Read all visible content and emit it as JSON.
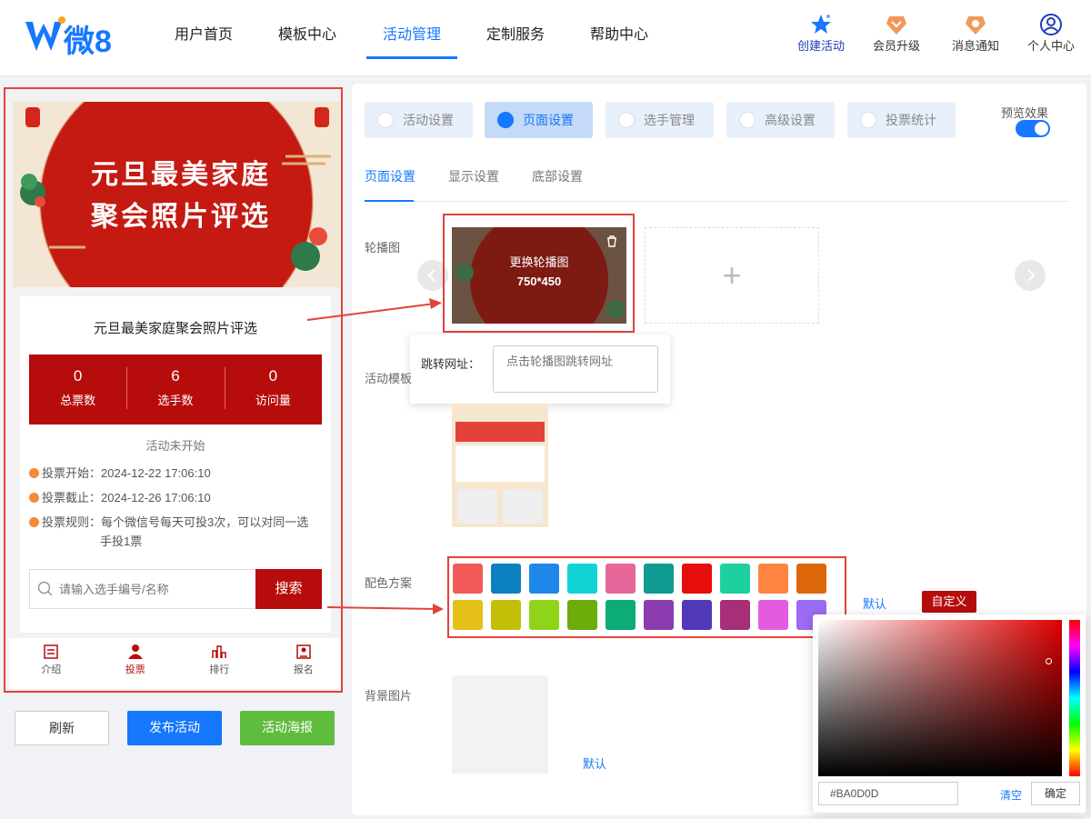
{
  "header": {
    "logo_text": "微8",
    "nav": [
      "用户首页",
      "模板中心",
      "活动管理",
      "定制服务",
      "帮助中心"
    ],
    "active_nav": "活动管理",
    "actions": [
      {
        "label": "创建活动",
        "icon": "star-icon"
      },
      {
        "label": "会员升级",
        "icon": "vip-badge-icon"
      },
      {
        "label": "消息通知",
        "icon": "bell-badge-icon"
      },
      {
        "label": "个人中心",
        "icon": "user-circle-icon"
      }
    ]
  },
  "preview": {
    "banner_line1": "元旦最美家庭",
    "banner_line2": "聚会照片评选",
    "title": "元旦最美家庭聚会照片评选",
    "stats": [
      {
        "value": "0",
        "label": "总票数"
      },
      {
        "value": "6",
        "label": "选手数"
      },
      {
        "value": "0",
        "label": "访问量"
      }
    ],
    "status": "活动未开始",
    "vote_start": "投票开始：2024-12-22 17:06:10",
    "vote_end": "投票截止：2024-12-26 17:06:10",
    "vote_rule": "投票规则：每个微信号每天可投3次，可以对同一选手投1票",
    "search_placeholder": "请输入选手编号/名称",
    "search_button": "搜索",
    "tabbar": [
      {
        "label": "介绍",
        "icon": "intro-icon"
      },
      {
        "label": "投票",
        "icon": "person-icon"
      },
      {
        "label": "排行",
        "icon": "ranking-icon"
      },
      {
        "label": "报名",
        "icon": "signup-icon"
      }
    ]
  },
  "buttons": {
    "refresh": "刷新",
    "publish": "发布活动",
    "poster": "活动海报"
  },
  "settings": {
    "tabs": [
      "活动设置",
      "页面设置",
      "选手管理",
      "高级设置",
      "投票统计"
    ],
    "active_tab": "页面设置",
    "preview_toggle_label": "预览效果",
    "preview_on": true,
    "sub_tabs": [
      "页面设置",
      "显示设置",
      "底部设置"
    ],
    "active_sub_tab": "页面设置",
    "carousel_label": "轮播图",
    "carousel_overlay": "更换轮播图",
    "carousel_size": "750*450",
    "jump_label": "跳转网址：",
    "jump_placeholder": "点击轮播图跳转网址",
    "template_label": "活动模板",
    "color_label": "配色方案",
    "colors": [
      "#f25a5a",
      "#0c80c0",
      "#1f86ea",
      "#10d3d3",
      "#e8679a",
      "#0f9a92",
      "#e60d0d",
      "#1ecf9f",
      "#fe8541",
      "#dc660a",
      "#e5c018",
      "#c3be07",
      "#8fd418",
      "#6cac0b",
      "#0cab78",
      "#8b3caf",
      "#5038b8",
      "#a82e79",
      "#e35cde",
      "#9b6cf4"
    ],
    "default_link": "默认",
    "custom_button": "自定义",
    "bg_label": "背景图片",
    "bg_default_link": "默认"
  },
  "picker": {
    "hex": "#BA0D0D",
    "clear": "清空",
    "confirm": "确定"
  },
  "accent": {
    "blue": "#1677ff",
    "red": "#b70c0c",
    "green": "#5fbd3e"
  }
}
